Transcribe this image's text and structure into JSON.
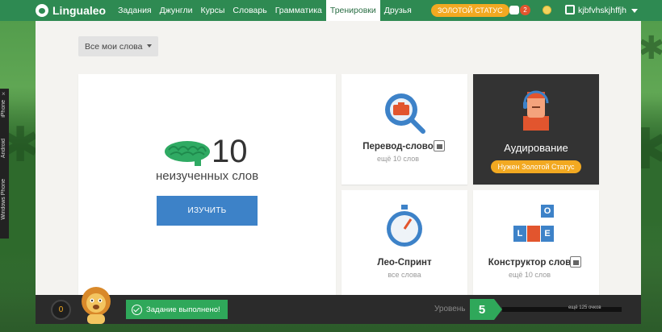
{
  "app": {
    "name": "Lingualeo"
  },
  "nav": {
    "items": [
      {
        "label": "Задания"
      },
      {
        "label": "Джунгли"
      },
      {
        "label": "Курсы"
      },
      {
        "label": "Словарь"
      },
      {
        "label": "Грамматика"
      },
      {
        "label": "Тренировки",
        "active": true
      },
      {
        "label": "Друзья"
      }
    ]
  },
  "header": {
    "gold_status": "ЗОЛОТОЙ СТАТУС",
    "notifications": "2",
    "username": "kjbfvhskjhffjh"
  },
  "side_panel": {
    "items": [
      "iPhone",
      "Android",
      "Windows Phone"
    ],
    "close": "×"
  },
  "filter": {
    "selected": "Все мои слова"
  },
  "words": {
    "count": "10",
    "label": "неизученных слов",
    "button": "ИЗУЧИТЬ"
  },
  "trainings": [
    {
      "title": "Перевод-слово",
      "subtitle": "ещё 10 слов",
      "icon": "magnifier-icon"
    },
    {
      "title": "Аудирование",
      "badge": "Нужен Золотой Статус",
      "icon": "headphones-man-icon"
    },
    {
      "title": "Лео-Спринт",
      "subtitle": "все слова",
      "icon": "stopwatch-icon"
    },
    {
      "title": "Конструктор слов",
      "subtitle": "ещё 10 слов",
      "icon": "letter-blocks-icon"
    }
  ],
  "constructor_letters": [
    "O",
    "L",
    "E"
  ],
  "bottom_bar": {
    "score": "0",
    "toast": "Задание выполнено!",
    "level_label": "Уровень",
    "level": "5",
    "xp_text": "ещё 125 очков"
  },
  "colors": {
    "nav_green": "#2e8a52",
    "gold": "#f2a921",
    "button_blue": "#3d82c8",
    "toast_green": "#2fa85a",
    "accent_red": "#e2552e"
  }
}
